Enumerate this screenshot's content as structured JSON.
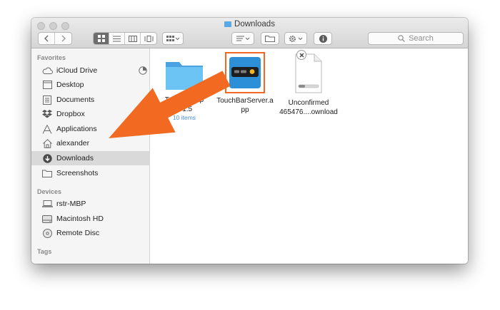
{
  "window": {
    "title": "Downloads"
  },
  "toolbar": {
    "search_placeholder": "Search"
  },
  "sidebar": {
    "favorites_header": "Favorites",
    "favorites": [
      {
        "label": "iCloud Drive",
        "icon": "cloud-icon"
      },
      {
        "label": "Desktop",
        "icon": "desktop-icon"
      },
      {
        "label": "Documents",
        "icon": "document-icon"
      },
      {
        "label": "Dropbox",
        "icon": "dropbox-icon"
      },
      {
        "label": "Applications",
        "icon": "applications-icon"
      },
      {
        "label": "alexander",
        "icon": "home-icon"
      },
      {
        "label": "Downloads",
        "icon": "download-icon",
        "selected": true
      },
      {
        "label": "Screenshots",
        "icon": "folder-icon"
      }
    ],
    "devices_header": "Devices",
    "devices": [
      {
        "label": "rstr-MBP",
        "icon": "laptop-icon"
      },
      {
        "label": "Macintosh HD",
        "icon": "hard-drive-icon"
      },
      {
        "label": "Remote Disc",
        "icon": "disc-icon"
      }
    ],
    "tags_header": "Tags"
  },
  "files": [
    {
      "line1": "TouchBarAp",
      "line2": "p 1.5",
      "sub": "10 items",
      "icon": "folder-icon"
    },
    {
      "line1": "TouchBarServer.a",
      "line2": "pp",
      "icon": "app-icon"
    },
    {
      "line1": "Unconfirmed",
      "line2": "465476....ownload",
      "icon": "download-file-icon"
    }
  ],
  "colors": {
    "arrow": "#f26a21",
    "app_highlight": "#f26a21",
    "selected_row": "#d9d9d9",
    "folder_blue": "#5cb8ef"
  }
}
